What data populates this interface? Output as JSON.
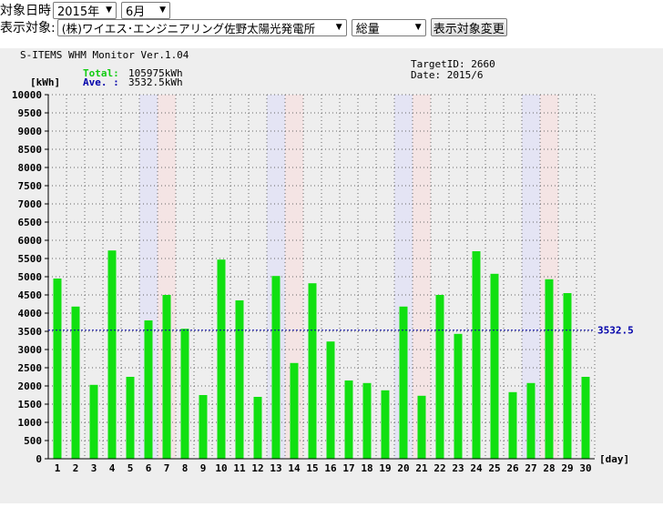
{
  "controls": {
    "date_label": "対象日時",
    "year_select": "2015年",
    "month_select": "6月",
    "target_label": "表示対象:",
    "target_select": "(株)ワイエス･エンジニアリング佐野太陽光発電所",
    "type_select": "総量",
    "change_button": "表示対象変更"
  },
  "header": {
    "app_title": "S-ITEMS WHM Monitor Ver.1.04",
    "total_label": "Total:",
    "total_value": "105975kWh",
    "ave_label": "Ave. :",
    "ave_value": "3532.5kWh",
    "target_id": "TargetID: 2660",
    "date": "Date: 2015/6"
  },
  "colors": {
    "bar": "#11e011",
    "total": "#11cc11",
    "ave": "#0000aa",
    "saturday_band": "#e4e4f4",
    "sunday_band": "#f4e4e4",
    "panel": "#eeeeee"
  },
  "chart_data": {
    "type": "bar",
    "ylabel": "[kWh]",
    "xlabel": "[day]",
    "ylim": [
      0,
      10000
    ],
    "ytick_step": 500,
    "grid": true,
    "categories": [
      "1",
      "2",
      "3",
      "4",
      "5",
      "6",
      "7",
      "8",
      "9",
      "10",
      "11",
      "12",
      "13",
      "14",
      "15",
      "16",
      "17",
      "18",
      "19",
      "20",
      "21",
      "22",
      "23",
      "24",
      "25",
      "26",
      "27",
      "28",
      "29",
      "30"
    ],
    "values": [
      4950,
      4180,
      2030,
      5720,
      2250,
      3800,
      4500,
      3570,
      1750,
      5470,
      4350,
      1700,
      5020,
      2630,
      4820,
      3220,
      2150,
      2080,
      1880,
      4180,
      1730,
      4500,
      3430,
      5700,
      5080,
      1830,
      2080,
      4930,
      4550,
      2250
    ],
    "saturdays": [
      "6",
      "13",
      "20",
      "27"
    ],
    "sundays": [
      "7",
      "14",
      "21",
      "28"
    ],
    "average_line": 3532.5,
    "average_label": "3532.5"
  }
}
